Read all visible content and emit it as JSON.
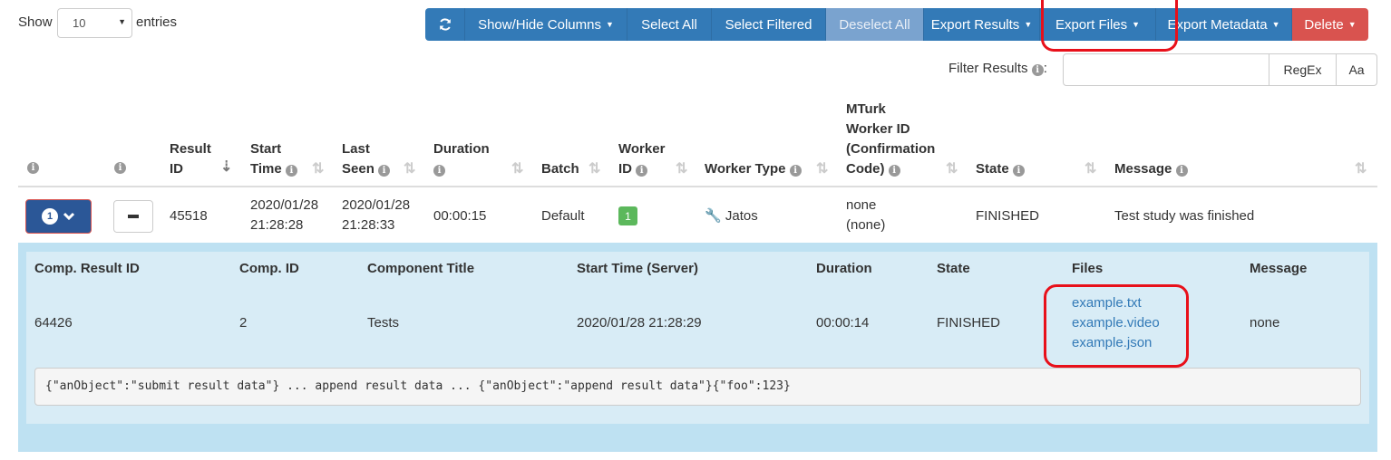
{
  "top": {
    "show_label": "Show",
    "entries_value": "10",
    "entries_label": "entries"
  },
  "toolbar": {
    "refresh_icon": "refresh-icon",
    "buttons": [
      {
        "label": "Show/Hide Columns",
        "dropdown": true
      },
      {
        "label": "Select All",
        "dropdown": false
      },
      {
        "label": "Select Filtered",
        "dropdown": false
      },
      {
        "label": "Deselect All",
        "dropdown": false,
        "disabled": true
      },
      {
        "label": "Export Results",
        "dropdown": true
      },
      {
        "label": "Export Files",
        "dropdown": true
      },
      {
        "label": "Export Metadata",
        "dropdown": true
      },
      {
        "label": "Delete",
        "dropdown": true
      }
    ]
  },
  "filter": {
    "label": "Filter Results",
    "colon": ":",
    "value": "",
    "regex_label": "RegEx",
    "case_label": "Aa"
  },
  "table": {
    "headers": {
      "result_id": [
        "Result",
        "ID"
      ],
      "start_time": [
        "Start",
        "Time"
      ],
      "last_seen": [
        "Last",
        "Seen"
      ],
      "duration": "Duration",
      "batch": "Batch",
      "worker_id": [
        "Worker",
        "ID"
      ],
      "worker_type": "Worker Type",
      "mturk": [
        "MTurk",
        "Worker ID",
        "(Confirmation",
        "Code)"
      ],
      "state": "State",
      "message": "Message"
    },
    "row": {
      "expand_count": "1",
      "result_id": "45518",
      "start_time": [
        "2020/01/28",
        "21:28:28"
      ],
      "last_seen": [
        "2020/01/28",
        "21:28:33"
      ],
      "duration": "00:00:15",
      "batch": "Default",
      "worker_id": "1",
      "worker_type": "Jatos",
      "mturk": [
        "none",
        "(none)"
      ],
      "state": "FINISHED",
      "message": "Test study was finished"
    }
  },
  "detail": {
    "headers": [
      "Comp. Result ID",
      "Comp. ID",
      "Component Title",
      "Start Time (Server)",
      "Duration",
      "State",
      "Files",
      "Message"
    ],
    "row": {
      "comp_result_id": "64426",
      "comp_id": "2",
      "title": "Tests",
      "start_time": "2020/01/28 21:28:29",
      "duration": "00:00:14",
      "state": "FINISHED",
      "files": [
        "example.txt",
        "example.video",
        "example.json"
      ],
      "message": "none"
    },
    "data": "{\"anObject\":\"submit result data\"} ... append result data ... {\"anObject\":\"append result data\"}{\"foo\":123}"
  },
  "colors": {
    "primary": "#337ab7",
    "danger": "#d9534f",
    "success": "#5cb85c",
    "detail_bg": "#d8ecf6",
    "highlight": "#e8101a"
  }
}
